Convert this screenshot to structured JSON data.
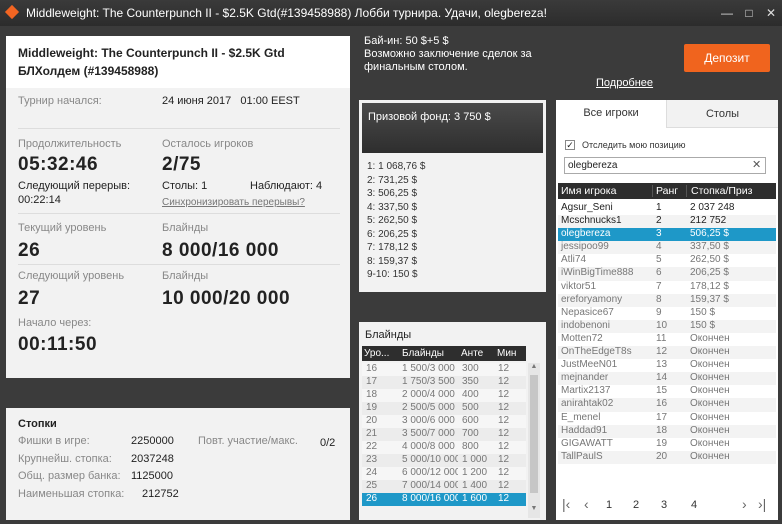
{
  "window": {
    "title": "Middleweight: The Counterpunch II - $2.5K Gtd(#139458988) Лобби турнира. Удачи, olegbereza!",
    "min": "—",
    "max": "□",
    "close": "✕"
  },
  "info": {
    "name_line1": "Middleweight: The Counterpunch II - $2.5K Gtd",
    "name_line2": "БЛХолдем (#139458988)",
    "started_label": "Турнир начался:",
    "started_value": "24 июня 2017   01:00 EEST",
    "duration_label": "Продолжительность",
    "duration_value": "05:32:46",
    "players_left_label": "Осталось игроков",
    "players_left_value": "2/75",
    "next_break_label": "Следующий перерыв:",
    "next_break_value": "00:22:14",
    "tables_label": "Столы: 1",
    "observers_label": "Наблюдают: 4",
    "sync_link": "Синхронизировать перерывы?",
    "cur_level_label": "Текущий уровень",
    "cur_level_value": "26",
    "cur_blinds_label": "Блайнды",
    "cur_blinds_value": "8 000/16 000",
    "next_level_label": "Следующий уровень",
    "next_level_value": "27",
    "next_blinds_label": "Блайнды",
    "next_blinds_value": "10 000/20 000",
    "start_in_label": "Начало через:",
    "start_in_value": "00:11:50"
  },
  "stacks": {
    "title": "Стопки",
    "chips_label": "Фишки в игре:",
    "chips_value": "2250000",
    "rebuy_label": "Повт. участие/макс.",
    "rebuy_value": "0/2",
    "largest_label": "Крупнейш. стопка:",
    "largest_value": "2037248",
    "total_label": "Общ. размер банка:",
    "total_value": "1125000",
    "smallest_label": "Наименьшая стопка:",
    "smallest_value": "212752"
  },
  "buyin": {
    "line1": "Бай-ин: 50 $+5 $",
    "line2": "Возможно заключение сделок за",
    "line3": "финальным столом.",
    "more_link": "Подробнее",
    "deposit_button": "Депозит"
  },
  "prize": {
    "header": "Призовой фонд: 3 750 $",
    "rows": [
      "1: 1 068,76 $",
      "2: 731,25 $",
      "3: 506,25 $",
      "4: 337,50 $",
      "5: 262,50 $",
      "6: 206,25 $",
      "7: 178,12 $",
      "8: 159,37 $",
      "9-10: 150 $"
    ]
  },
  "blinds": {
    "title": "Блайнды",
    "headers": [
      "Уро...",
      "Блайнды",
      "Анте",
      "Мин"
    ],
    "rows": [
      [
        "16",
        "1 500/3 000",
        "300",
        "12"
      ],
      [
        "17",
        "1 750/3 500",
        "350",
        "12"
      ],
      [
        "18",
        "2 000/4 000",
        "400",
        "12"
      ],
      [
        "19",
        "2 500/5 000",
        "500",
        "12"
      ],
      [
        "20",
        "3 000/6 000",
        "600",
        "12"
      ],
      [
        "21",
        "3 500/7 000",
        "700",
        "12"
      ],
      [
        "22",
        "4 000/8 000",
        "800",
        "12"
      ],
      [
        "23",
        "5 000/10 000",
        "1 000",
        "12"
      ],
      [
        "24",
        "6 000/12 000",
        "1 200",
        "12"
      ],
      [
        "25",
        "7 000/14 000",
        "1 400",
        "12"
      ],
      [
        "26",
        "8 000/16 000",
        "1 600",
        "12"
      ]
    ],
    "selected_index": 10
  },
  "players": {
    "tab_all": "Все игроки",
    "tab_tables": "Столы",
    "track_label": "Отследить мою позицию",
    "search_value": "olegbereza",
    "headers": [
      "Имя игрока",
      "Ранг",
      "Стопка/Приз"
    ],
    "rows": [
      [
        "Agsur_Seni",
        "1",
        "2 037 248"
      ],
      [
        "Mcschnucks1",
        "2",
        "212 752"
      ],
      [
        "olegbereza",
        "3",
        "506,25 $"
      ],
      [
        "jessipoo99",
        "4",
        "337,50 $"
      ],
      [
        "Atli74",
        "5",
        "262,50 $"
      ],
      [
        "iWinBigTime888",
        "6",
        "206,25 $"
      ],
      [
        "viktor51",
        "7",
        "178,12 $"
      ],
      [
        "ereforyamony",
        "8",
        "159,37 $"
      ],
      [
        "Nepasice67",
        "9",
        "150 $"
      ],
      [
        "indobenoni",
        "10",
        "150 $"
      ],
      [
        "Motten72",
        "11",
        "Окончен"
      ],
      [
        "OnTheEdgeT8s",
        "12",
        "Окончен"
      ],
      [
        "JustMeeN01",
        "13",
        "Окончен"
      ],
      [
        "mejnander",
        "14",
        "Окончен"
      ],
      [
        "Martix2137",
        "15",
        "Окончен"
      ],
      [
        "anirahtak02",
        "16",
        "Окончен"
      ],
      [
        "E_menel",
        "17",
        "Окончен"
      ],
      [
        "Haddad91",
        "18",
        "Окончен"
      ],
      [
        "GIGAWATT",
        "19",
        "Окончен"
      ],
      [
        "TallPaulS",
        "20",
        "Окончен"
      ]
    ],
    "selected_index": 2,
    "pages": [
      "1",
      "2",
      "3",
      "4"
    ]
  },
  "colors": {
    "accent_orange": "#f0641e",
    "selection_blue": "#1e98c8",
    "header_dark": "#3b3b3b"
  }
}
